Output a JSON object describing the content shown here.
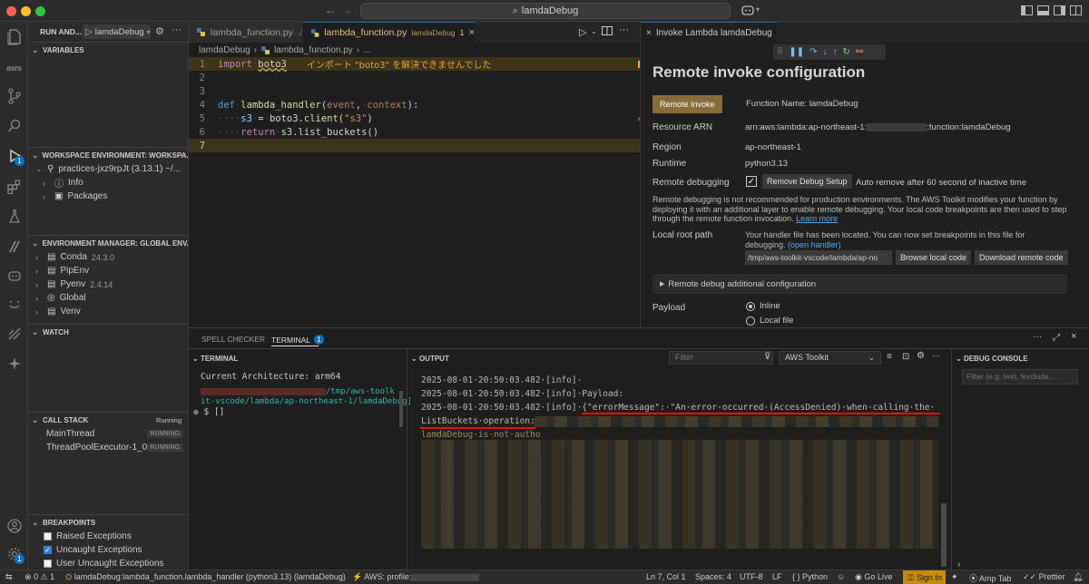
{
  "titlebar": {
    "search_text": "lamdaDebug"
  },
  "activitybar": {
    "run_badge": "1",
    "settings_badge": "1"
  },
  "sidebar": {
    "run_header": "RUN AND...",
    "run_config": "lamdaDebug",
    "variables_header": "VARIABLES",
    "workspace_env_header": "WORKSPACE ENVIRONMENT: WORKSPA...",
    "workspace_env_item": "practices-jxz9rpJt (3.13.1) ~/...",
    "workspace_children": [
      "Info",
      "Packages"
    ],
    "env_manager_header": "ENVIRONMENT MANAGER: GLOBAL ENV...",
    "env_managers": [
      {
        "name": "Conda",
        "version": "24.3.0"
      },
      {
        "name": "PipEnv",
        "version": ""
      },
      {
        "name": "Pyenv",
        "version": "2.4.14"
      },
      {
        "name": "Global",
        "version": ""
      },
      {
        "name": "Venv",
        "version": ""
      }
    ],
    "watch_header": "WATCH",
    "callstack_header": "CALL STACK",
    "callstack_status": "Running",
    "threads": [
      {
        "name": "MainThread",
        "status": "RUNNING"
      },
      {
        "name": "ThreadPoolExecutor-1_0",
        "status": "RUNNING"
      }
    ],
    "breakpoints_header": "BREAKPOINTS",
    "breakpoints": [
      {
        "label": "Raised Exceptions",
        "checked": false
      },
      {
        "label": "Uncaught Exceptions",
        "checked": true
      },
      {
        "label": "User Uncaught Exceptions",
        "checked": false
      }
    ]
  },
  "editor": {
    "tabs": [
      {
        "name": "lambda_function.py",
        "suffix": "./",
        "active": false
      },
      {
        "name": "lambda_function.py",
        "suffix": "lamdaDebug",
        "count": "1",
        "active": true
      }
    ],
    "breadcrumb": [
      "lamdaDebug",
      "lambda_function.py",
      "..."
    ],
    "line_numbers": [
      "1",
      "2",
      "3",
      "4",
      "5",
      "6",
      "7"
    ],
    "code": {
      "l1_import": "import",
      "l1_module": "boto3",
      "l1_diagnostic": "インポート \"boto3\" を解決できませんでした",
      "l4_def": "def",
      "l4_fn": "lambda_handler",
      "l4_p1": "event",
      "l4_p2": "context",
      "l5_var": "s3",
      "l5_mod": "boto3",
      "l5_call": ".client(",
      "l5_str": "\"s3\"",
      "l6_return": "return",
      "l6_expr": "s3.list_buckets()"
    }
  },
  "webview": {
    "tab_title": "Invoke Lambda lamdaDebug",
    "heading": "Remote invoke configuration",
    "remote_invoke_button": "Remote Invoke",
    "function_name_label": "Function Name:",
    "function_name": "lamdaDebug",
    "resource_arn_label": "Resource ARN",
    "resource_arn_prefix": "arn:aws:lambda:ap-northeast-1:",
    "resource_arn_suffix": ":function:lamdaDebug",
    "region_label": "Region",
    "region": "ap-northeast-1",
    "runtime_label": "Runtime",
    "runtime": "python3.13",
    "remote_debugging_label": "Remote debugging",
    "remove_debug_button": "Remove Debug Setup",
    "auto_remove_text": "Auto remove after 60 second of inactive time",
    "warning_text": "Remote debugging is not recommended for production environments. The AWS Toolkit modifies your function by deploying it with an additional layer to enable remote debugging. Your local code breakpoints are then used to step through the remote function invocation.",
    "learn_more": "Learn more",
    "local_root_label": "Local root path",
    "handler_text": "Your handler file has been located. You can now set breakpoints in this file for debugging.",
    "open_handler": "(open handler)",
    "local_root_value": "/tmp/aws-toolkit-vscode/lambda/ap-no",
    "browse_button": "Browse local code",
    "download_button": "Download remote code",
    "additional_config": "Remote debug additional configuration",
    "payload_label": "Payload",
    "payload_options": [
      "Inline",
      "Local file"
    ]
  },
  "panel": {
    "tabs": [
      {
        "label": "SPELL CHECKER"
      },
      {
        "label": "TERMINAL",
        "badge": "1"
      }
    ],
    "terminal_header": "TERMINAL",
    "terminal_line1": "Current Architecture: arm64",
    "terminal_path1": "/tmp/aws-toolk",
    "terminal_path2": "it-vscode/lambda/ap-northeast-1/lamdaDebug]",
    "terminal_prompt": "$ []",
    "output_header": "OUTPUT",
    "output_filter_placeholder": "Filter",
    "output_channel": "AWS Toolkit",
    "output_lines": [
      "2025-08-01·20:50:03.482·[info]·",
      "2025-08-01·20:50:03.482·[info]·Payload:",
      "2025-08-01·20:50:03.482·[info]·{\"errorMessage\":·\"An·error·occurred·(AccessDenied)·when·calling·the·",
      "ListBuckets·operation:·",
      "lamdaDebug·is·not·autho"
    ],
    "debug_console_header": "DEBUG CONSOLE",
    "debug_filter_placeholder": "Filter (e.g. text, !exclude,..."
  },
  "statusbar": {
    "errors": "0",
    "warnings": "1",
    "debug_target": "lamdaDebug:lambda_function.lambda_handler (python3.13) (lamdaDebug)",
    "aws_profile": "AWS: profile:",
    "position": "Ln 7, Col 1",
    "spaces": "Spaces: 4",
    "encoding": "UTF-8",
    "eol": "LF",
    "language": "Python",
    "golive": "Go Live",
    "signin": "Sign In",
    "amptab": "Amp Tab",
    "prettier": "Prettier"
  },
  "colors": {
    "accent": "#0e70c0",
    "signin_bg": "#c48b0c",
    "line_highlight": "#3d3318",
    "error_underline": "#e51400"
  }
}
